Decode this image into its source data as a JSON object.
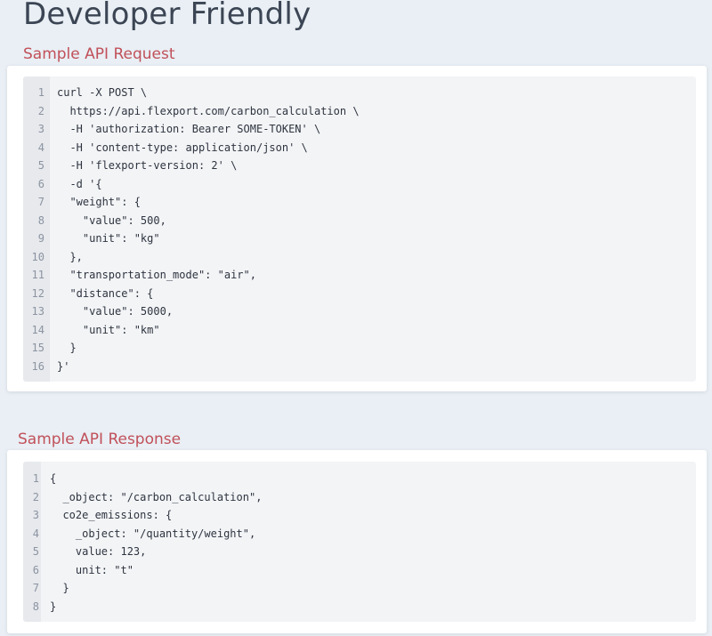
{
  "page": {
    "title": "Developer Friendly"
  },
  "request": {
    "title": "Sample API Request",
    "lines": [
      {
        "num": "1",
        "text": "curl -X POST \\"
      },
      {
        "num": "2",
        "text": "  https://api.flexport.com/carbon_calculation \\"
      },
      {
        "num": "3",
        "text": "  -H 'authorization: Bearer SOME-TOKEN' \\"
      },
      {
        "num": "4",
        "text": "  -H 'content-type: application/json' \\"
      },
      {
        "num": "5",
        "text": "  -H 'flexport-version: 2' \\"
      },
      {
        "num": "6",
        "text": "  -d '{"
      },
      {
        "num": "7",
        "text": "  \"weight\": {"
      },
      {
        "num": "8",
        "text": "    \"value\": 500,"
      },
      {
        "num": "9",
        "text": "    \"unit\": \"kg\""
      },
      {
        "num": "10",
        "text": "  },"
      },
      {
        "num": "11",
        "text": "  \"transportation_mode\": \"air\","
      },
      {
        "num": "12",
        "text": "  \"distance\": {"
      },
      {
        "num": "13",
        "text": "    \"value\": 5000,"
      },
      {
        "num": "14",
        "text": "    \"unit\": \"km\""
      },
      {
        "num": "15",
        "text": "  }"
      },
      {
        "num": "16",
        "text": "}'"
      }
    ]
  },
  "response": {
    "title": "Sample API Response",
    "lines": [
      {
        "num": "1",
        "text": "{"
      },
      {
        "num": "2",
        "text": "  _object: \"/carbon_calculation\","
      },
      {
        "num": "3",
        "text": "  co2e_emissions: {"
      },
      {
        "num": "4",
        "text": "    _object: \"/quantity/weight\","
      },
      {
        "num": "5",
        "text": "    value: 123,"
      },
      {
        "num": "6",
        "text": "    unit: \"t\""
      },
      {
        "num": "7",
        "text": "  }"
      },
      {
        "num": "8",
        "text": "}"
      }
    ]
  }
}
